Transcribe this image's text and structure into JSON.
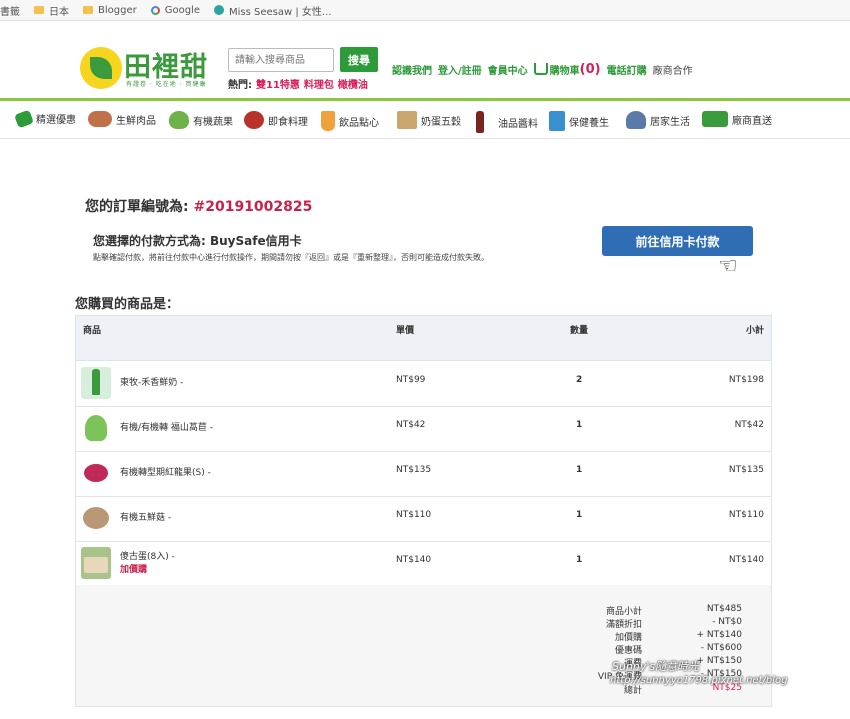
{
  "bookmarks": [
    "書籤",
    "日本",
    "Blogger",
    "Google",
    "Miss Seesaw | 女性..."
  ],
  "header": {
    "logo_text": "田裡甜",
    "slogan": "有證卷 · 吃在地 · 買健康",
    "search_placeholder": "請輸入搜尋商品",
    "search_button": "搜尋",
    "hot_label": "熱門:",
    "hot_items": [
      "雙11特惠",
      "料理包",
      "橄欖油"
    ],
    "nav": [
      "認識我們",
      "登入/註冊",
      "會員中心"
    ],
    "cart_label": "購物車",
    "cart_count": "(0)",
    "phone_order": "電話訂購",
    "vendor_coop": "廠商合作"
  },
  "categories": [
    {
      "label": "精選優惠",
      "color": "#2e9b3a"
    },
    {
      "label": "生鮮肉品",
      "color": "#c0714a"
    },
    {
      "label": "有機蔬果",
      "color": "#6fb24a"
    },
    {
      "label": "即食料理",
      "color": "#b8322a"
    },
    {
      "label": "飲品點心",
      "color": "#f0a23a"
    },
    {
      "label": "奶蛋五穀",
      "color": "#c9a66b"
    },
    {
      "label": "油品醬料",
      "color": "#7a2420"
    },
    {
      "label": "保健養生",
      "color": "#3a8fd0"
    },
    {
      "label": "居家生活",
      "color": "#5a7aa8"
    },
    {
      "label": "廠商直送",
      "color": "#3a9a3c"
    }
  ],
  "order": {
    "number_label": "您的訂單編號為:",
    "number": "#20191002825",
    "payment_label": "您選擇的付款方式為: BuySafe信用卡",
    "payment_note": "點擊確認付款，將前往付款中心進行付款操作，期間請勿按『返回』或是『重新整理』，否則可能造成付款失敗。",
    "pay_button": "前往信用卡付款"
  },
  "products_title": "您購買的商品是：",
  "table": {
    "headers": [
      "商品",
      "單價",
      "數量",
      "小計"
    ],
    "rows": [
      {
        "name": "東牧-禾香鮮奶 -",
        "price": "NT$99",
        "qty": "2",
        "subtotal": "NT$198",
        "addon": "",
        "thumb": "#d8eedc"
      },
      {
        "name": "有機/有機轉 福山萵苣 -",
        "price": "NT$42",
        "qty": "1",
        "subtotal": "NT$42",
        "addon": "",
        "thumb": "#7cc35a"
      },
      {
        "name": "有機轉型期紅龍果(S) -",
        "price": "NT$135",
        "qty": "1",
        "subtotal": "NT$135",
        "addon": "",
        "thumb": "#c02a5a"
      },
      {
        "name": "有機五鮮菇 -",
        "price": "NT$110",
        "qty": "1",
        "subtotal": "NT$110",
        "addon": "",
        "thumb": "#b99877"
      },
      {
        "name": "傻古蛋(8入) -",
        "price": "NT$140",
        "qty": "1",
        "subtotal": "NT$140",
        "addon": "加價購",
        "thumb": "#a8c48a"
      }
    ]
  },
  "summary": [
    {
      "label": "商品小計",
      "value": "NT$485"
    },
    {
      "label": "滿額折扣",
      "value": "- NT$0"
    },
    {
      "label": "加價購",
      "value": "+ NT$140"
    },
    {
      "label": "優惠碼",
      "value": "- NT$600"
    },
    {
      "label": "運費",
      "value": "+ NT$150"
    },
    {
      "label": "VIP 免運費",
      "value": "- NT$150"
    },
    {
      "label": "總計",
      "value": "NT$25"
    }
  ],
  "watermark": {
    "line1": "Sunny's隨意時光",
    "line2": "http://sunnyyo1798.pixnet.net/blog"
  }
}
